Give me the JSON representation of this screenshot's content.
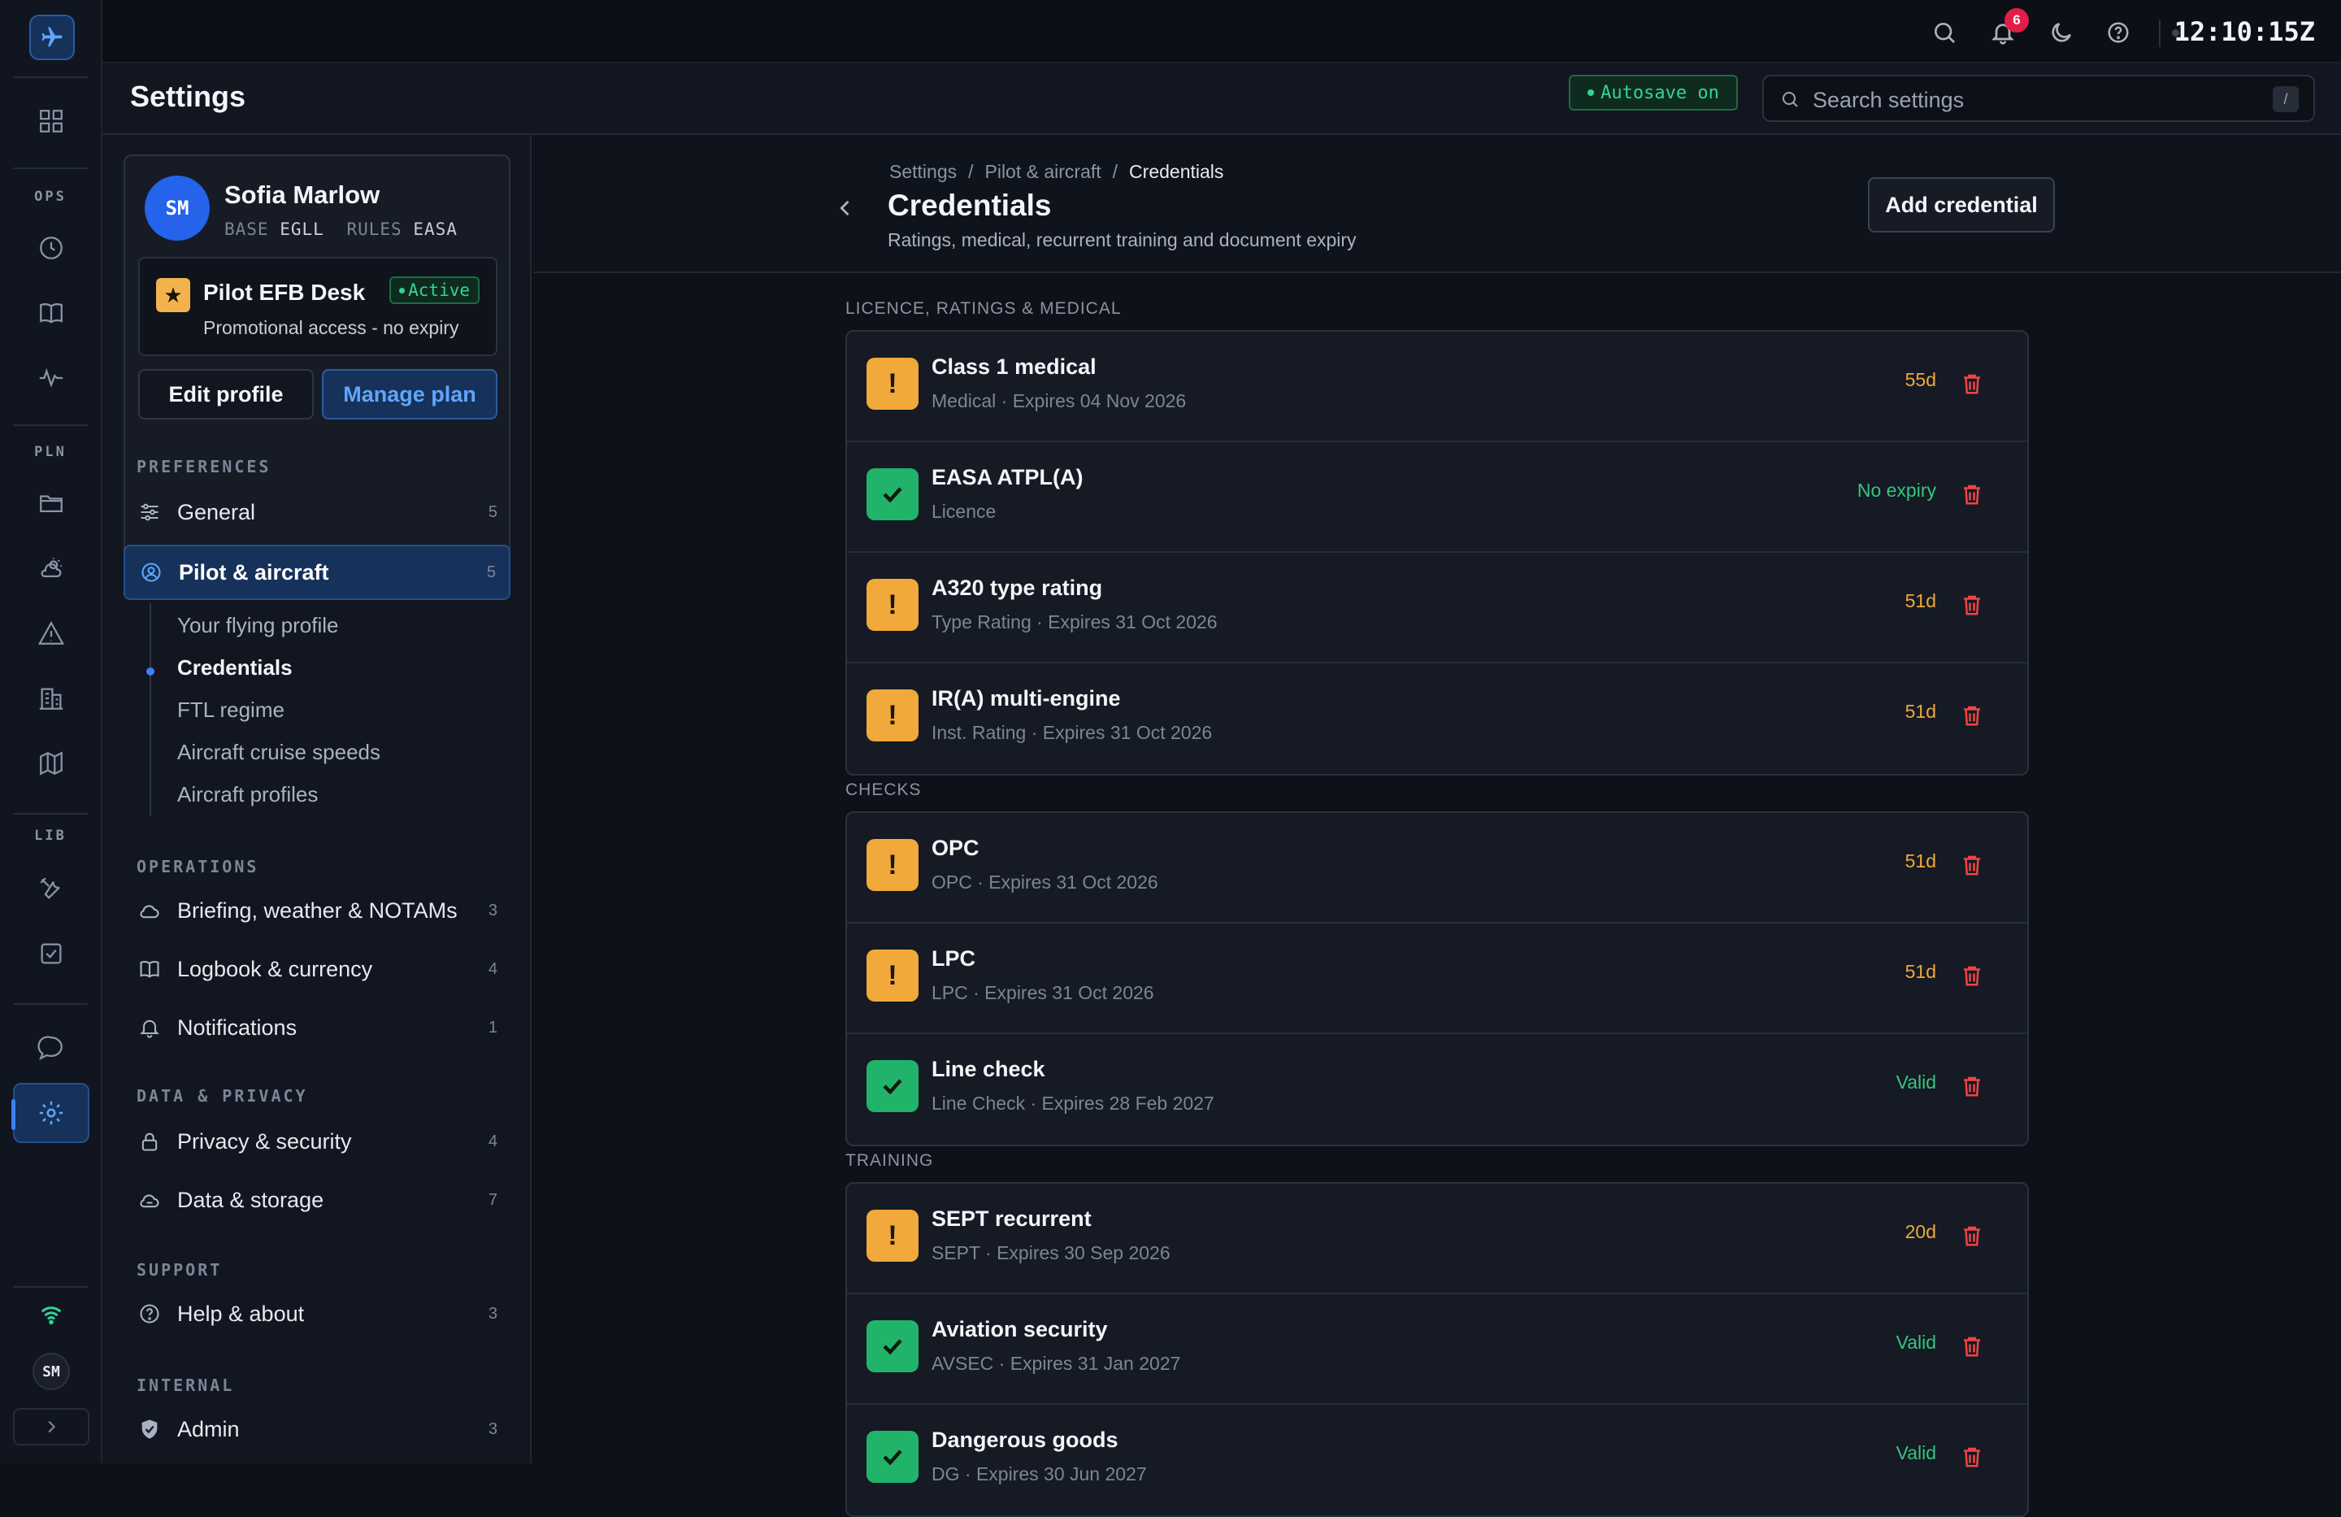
{
  "app": {
    "clock": "12:10:15Z",
    "notification_count": "6"
  },
  "rail": {
    "sections": [
      {
        "label": "OPS"
      },
      {
        "label": "PLN"
      },
      {
        "label": "LIB"
      }
    ],
    "avatar": "SM"
  },
  "header": {
    "title": "Settings",
    "autosave": "Autosave on",
    "search_placeholder": "Search settings",
    "search_shortcut": "/"
  },
  "profile": {
    "initials": "SM",
    "name": "Sofia Marlow",
    "base_key": "BASE",
    "base_val": "EGLL",
    "rules_key": "RULES",
    "rules_val": "EASA",
    "plan_name": "Pilot EFB Desk",
    "plan_status": "Active",
    "plan_desc": "Promotional access - no expiry",
    "edit_label": "Edit profile",
    "manage_label": "Manage plan"
  },
  "sidebar": {
    "preferences": "PREFERENCES",
    "general": {
      "label": "General",
      "count": "5"
    },
    "pilot": {
      "label": "Pilot & aircraft",
      "count": "5"
    },
    "sub": [
      "Your flying profile",
      "Credentials",
      "FTL regime",
      "Aircraft cruise speeds",
      "Aircraft profiles"
    ],
    "operations": "OPERATIONS",
    "briefing": {
      "label": "Briefing, weather & NOTAMs",
      "count": "3"
    },
    "logbook": {
      "label": "Logbook & currency",
      "count": "4"
    },
    "notifications": {
      "label": "Notifications",
      "count": "1"
    },
    "data_privacy": "DATA & PRIVACY",
    "privacy": {
      "label": "Privacy & security",
      "count": "4"
    },
    "storage": {
      "label": "Data & storage",
      "count": "7"
    },
    "support": "SUPPORT",
    "help": {
      "label": "Help & about",
      "count": "3"
    },
    "internal": "INTERNAL",
    "admin": {
      "label": "Admin",
      "count": "3"
    }
  },
  "main": {
    "breadcrumb": [
      "Settings",
      "Pilot & aircraft",
      "Credentials"
    ],
    "title": "Credentials",
    "subtitle": "Ratings, medical, recurrent training and document expiry",
    "add_label": "Add credential",
    "groups": [
      {
        "label": "LICENCE, RATINGS & MEDICAL",
        "items": [
          {
            "title": "Class 1 medical",
            "sub": "Medical · Expires 04 Nov 2026",
            "status": "55d",
            "state": "warn"
          },
          {
            "title": "EASA ATPL(A)",
            "sub": "Licence",
            "status": "No expiry",
            "state": "ok"
          },
          {
            "title": "A320 type rating",
            "sub": "Type Rating · Expires 31 Oct 2026",
            "status": "51d",
            "state": "warn"
          },
          {
            "title": "IR(A) multi-engine",
            "sub": "Inst. Rating · Expires 31 Oct 2026",
            "status": "51d",
            "state": "warn"
          }
        ]
      },
      {
        "label": "CHECKS",
        "items": [
          {
            "title": "OPC",
            "sub": "OPC · Expires 31 Oct 2026",
            "status": "51d",
            "state": "warn"
          },
          {
            "title": "LPC",
            "sub": "LPC · Expires 31 Oct 2026",
            "status": "51d",
            "state": "warn"
          },
          {
            "title": "Line check",
            "sub": "Line Check · Expires 28 Feb 2027",
            "status": "Valid",
            "state": "ok"
          }
        ]
      },
      {
        "label": "TRAINING",
        "items": [
          {
            "title": "SEPT recurrent",
            "sub": "SEPT · Expires 30 Sep 2026",
            "status": "20d",
            "state": "warn"
          },
          {
            "title": "Aviation security",
            "sub": "AVSEC · Expires 31 Jan 2027",
            "status": "Valid",
            "state": "ok"
          },
          {
            "title": "Dangerous goods",
            "sub": "DG · Expires 30 Jun 2027",
            "status": "Valid",
            "state": "ok"
          }
        ]
      }
    ]
  }
}
